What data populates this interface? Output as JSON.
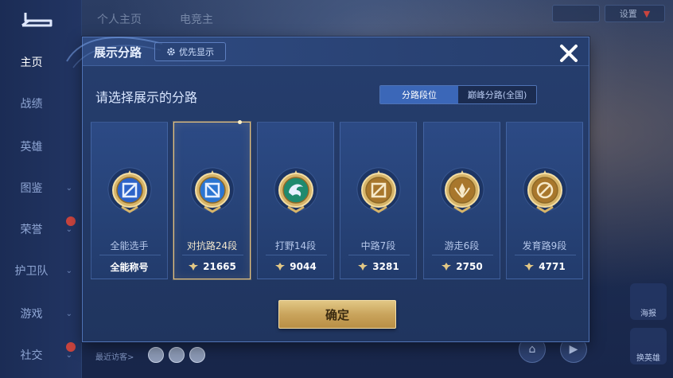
{
  "background": {
    "top_tabs": [
      "个人主页",
      "电竞主"
    ],
    "top_right": {
      "settings_label": "设置"
    },
    "left_nav": [
      {
        "label": "主页",
        "active": true,
        "chevron": false,
        "badge": false
      },
      {
        "label": "战绩",
        "active": false,
        "chevron": false,
        "badge": false
      },
      {
        "label": "英雄",
        "active": false,
        "chevron": false,
        "badge": false
      },
      {
        "label": "图鉴",
        "active": false,
        "chevron": true,
        "badge": false
      },
      {
        "label": "荣誉",
        "active": false,
        "chevron": true,
        "badge": true
      },
      {
        "label": "护卫队",
        "active": false,
        "chevron": true,
        "badge": false
      },
      {
        "label": "游戏",
        "active": false,
        "chevron": true,
        "badge": false
      },
      {
        "label": "社交",
        "active": false,
        "chevron": true,
        "badge": true
      }
    ],
    "recent_visitors_label": "最近访客>",
    "side_buttons": {
      "poster": "海报",
      "change_hero": "换英雄"
    }
  },
  "modal": {
    "title": "展示分路",
    "priority_button": "优先显示",
    "subtitle": "请选择展示的分路",
    "segment": {
      "options": [
        "分路段位",
        "巅峰分路(全国)"
      ],
      "active_index": 0
    },
    "cards": [
      {
        "name": "全能选手",
        "stat": "全能称号",
        "has_stat_icon": false,
        "selected": false,
        "badge_color": "#2d63c8",
        "icon": "all-round-icon"
      },
      {
        "name": "对抗路24段",
        "stat": "21665",
        "has_stat_icon": true,
        "selected": true,
        "badge_color": "#2b75d2",
        "icon": "clash-lane-icon"
      },
      {
        "name": "打野14段",
        "stat": "9044",
        "has_stat_icon": true,
        "selected": false,
        "badge_color": "#1f8a6e",
        "icon": "jungle-icon"
      },
      {
        "name": "中路7段",
        "stat": "3281",
        "has_stat_icon": true,
        "selected": false,
        "badge_color": "#a8772c",
        "icon": "mid-lane-icon"
      },
      {
        "name": "游走6段",
        "stat": "2750",
        "has_stat_icon": true,
        "selected": false,
        "badge_color": "#a8772c",
        "icon": "roam-icon"
      },
      {
        "name": "发育路9段",
        "stat": "4771",
        "has_stat_icon": true,
        "selected": false,
        "badge_color": "#a8772c",
        "icon": "farm-lane-icon"
      }
    ],
    "confirm_label": "确定"
  },
  "colors": {
    "modal_bg": "#263e6e",
    "accent_blue": "#3b67b8",
    "gold": "#d4b06a",
    "selected_border": "#e6c27e"
  }
}
